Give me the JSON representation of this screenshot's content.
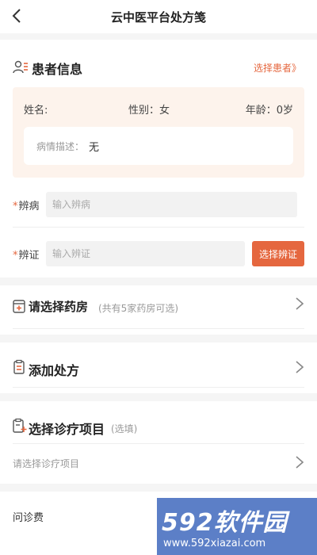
{
  "header": {
    "title": "云中医平台处方笺"
  },
  "patient": {
    "section_title": "患者信息",
    "select_link": "选择患者》",
    "name_label": "姓名:",
    "gender_label": "性别：女",
    "age_label": "年龄：0岁",
    "desc_label": "病情描述：",
    "desc_value": "无"
  },
  "diagnosis": {
    "required_mark": "*",
    "disease_label": "辨病",
    "disease_placeholder": "输入辨病",
    "syndrome_label": "辨证",
    "syndrome_placeholder": "输入辨证",
    "syndrome_button": "选择辨证"
  },
  "pharmacy": {
    "title": "请选择药房",
    "note": "(共有5家药房可选)"
  },
  "prescription": {
    "title": "添加处方"
  },
  "treatment": {
    "title": "选择诊疗项目",
    "note": "(选填)",
    "placeholder": "请选择诊疗项目"
  },
  "fee": {
    "label": "问诊费"
  },
  "watermark": {
    "brand": "592软件园",
    "url": "www.592xiazai.com"
  },
  "colors": {
    "accent": "#e5673f",
    "patient_bg": "#fdf3ec",
    "watermark_bg": "#5c7fc7"
  },
  "icons": {
    "back": "chevron-left-icon",
    "patient": "user-list-icon",
    "pharmacy": "pharmacy-box-icon",
    "prescription": "clipboard-icon",
    "treatment": "clipboard-plus-icon",
    "chevron": "chevron-right-icon"
  }
}
